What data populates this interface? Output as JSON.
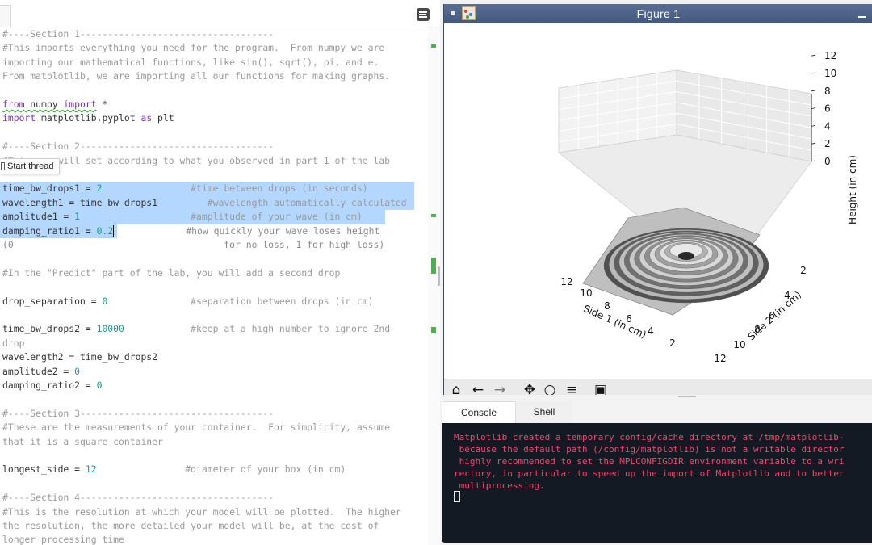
{
  "editor": {
    "lines": [
      {
        "top": 0,
        "parts": [
          {
            "t": "#----Section 1-----------------------------------",
            "c": "cm"
          }
        ]
      },
      {
        "top": 17.4,
        "parts": [
          {
            "t": "#This imports everything you need for the program.  From numpy we are",
            "c": "cm"
          }
        ]
      },
      {
        "top": 34.8,
        "parts": [
          {
            "t": "importing our mathematical functions, like sin(), sqrt(), pi, and e.",
            "c": "cm"
          }
        ]
      },
      {
        "top": 52.2,
        "parts": [
          {
            "t": "From matplotlib, we are importing all our functions for making graphs.",
            "c": "cm"
          }
        ]
      },
      {
        "top": 87,
        "parts": [
          {
            "t": "from",
            "c": "kw squiggle"
          },
          {
            "t": " numpy ",
            "c": "squiggle"
          },
          {
            "t": "import",
            "c": "kw squiggle"
          },
          {
            "t": " *",
            "c": ""
          }
        ]
      },
      {
        "top": 104.4,
        "parts": [
          {
            "t": "import",
            "c": "kw"
          },
          {
            "t": " matplotlib.pyplot ",
            "c": ""
          },
          {
            "t": "as",
            "c": "kw"
          },
          {
            "t": " plt",
            "c": ""
          }
        ]
      },
      {
        "top": 139.2,
        "parts": [
          {
            "t": "#----Section 2-----------------------------------",
            "c": "cm"
          }
        ]
      },
      {
        "top": 156.6,
        "parts": [
          {
            "t": "#This you will set according to what you observed in part 1 of the lab",
            "c": "cm"
          }
        ]
      },
      {
        "top": 191.4,
        "parts": [
          {
            "t": "time_bw_drops1 = ",
            "c": ""
          },
          {
            "t": "2",
            "c": "num"
          },
          {
            "t": "                #time between drops (in seconds)",
            "c": "cm"
          }
        ]
      },
      {
        "top": 208.8,
        "parts": [
          {
            "t": "wavelength1 = time_bw_drops1         ",
            "c": ""
          },
          {
            "t": "#wavelength automatically calculated",
            "c": "cm"
          }
        ]
      },
      {
        "top": 226.2,
        "parts": [
          {
            "t": "amplitude1 = ",
            "c": ""
          },
          {
            "t": "1",
            "c": "num"
          },
          {
            "t": "                    #amplitude of your wave (in cm)",
            "c": "cm"
          }
        ]
      },
      {
        "top": 243.6,
        "parts": [
          {
            "t": "damping_ratio1 = ",
            "c": ""
          },
          {
            "t": "0.2",
            "c": "num"
          },
          {
            "t": "|",
            "c": "caret"
          },
          {
            "t": "             #how quickly your wave loses height",
            "c": "cm-dark"
          }
        ]
      },
      {
        "top": 261,
        "parts": [
          {
            "t": "(0                                      for no loss, 1 for high loss)",
            "c": "cm-dark"
          }
        ]
      },
      {
        "top": 295.8,
        "parts": [
          {
            "t": "#In the \"Predict\" part of the lab, you will add a second drop",
            "c": "cm"
          }
        ]
      },
      {
        "top": 330.6,
        "parts": [
          {
            "t": "drop_separation = ",
            "c": ""
          },
          {
            "t": "0",
            "c": "num"
          },
          {
            "t": "               #separation between drops (in cm)",
            "c": "cm"
          }
        ]
      },
      {
        "top": 365.4,
        "parts": [
          {
            "t": "time_bw_drops2 = ",
            "c": ""
          },
          {
            "t": "10000",
            "c": "num"
          },
          {
            "t": "            #keep at a high number to ignore 2nd",
            "c": "cm"
          }
        ]
      },
      {
        "top": 382.8,
        "parts": [
          {
            "t": "drop",
            "c": "cm"
          }
        ]
      },
      {
        "top": 400.2,
        "parts": [
          {
            "t": "wavelength2 = time_bw_drops2",
            "c": ""
          }
        ]
      },
      {
        "top": 417.6,
        "parts": [
          {
            "t": "amplitude2 = ",
            "c": ""
          },
          {
            "t": "0",
            "c": "num"
          }
        ]
      },
      {
        "top": 435,
        "parts": [
          {
            "t": "damping_ratio2 = ",
            "c": ""
          },
          {
            "t": "0",
            "c": "num"
          }
        ]
      },
      {
        "top": 469.8,
        "parts": [
          {
            "t": "#----Section 3-----------------------------------",
            "c": "cm"
          }
        ]
      },
      {
        "top": 487.2,
        "parts": [
          {
            "t": "#These are the measurements of your container.  For simplicity, assume",
            "c": "cm"
          }
        ]
      },
      {
        "top": 504.6,
        "parts": [
          {
            "t": "that it is a square container",
            "c": "cm"
          }
        ]
      },
      {
        "top": 539.4,
        "parts": [
          {
            "t": "longest_side = ",
            "c": ""
          },
          {
            "t": "12",
            "c": "num"
          },
          {
            "t": "                #diameter of your box (in cm)",
            "c": "cm"
          }
        ]
      },
      {
        "top": 574.2,
        "parts": [
          {
            "t": "#----Section 4-----------------------------------",
            "c": "cm"
          }
        ]
      },
      {
        "top": 591.6,
        "parts": [
          {
            "t": "#This is the resolution at which your model will be plotted.  The higher",
            "c": "cm"
          }
        ]
      },
      {
        "top": 609,
        "parts": [
          {
            "t": "the resolution, the more detailed your model will be, at the cost of",
            "c": "cm"
          }
        ]
      },
      {
        "top": 626.4,
        "parts": [
          {
            "t": "longer processing time",
            "c": "cm"
          }
        ]
      }
    ],
    "start_thread_label": "Start thread"
  },
  "figure": {
    "title": "Figure 1",
    "toolbar_icons": [
      "home-icon",
      "back-icon",
      "forward-icon",
      "pan-icon",
      "zoom-icon",
      "configure-icon",
      "save-icon"
    ]
  },
  "chart_data": {
    "type": "surface3d",
    "zlabel": "Height (in cm)",
    "xlabel": "Side 1 (in cm)",
    "ylabel": "Side 2 (in cm)",
    "z_ticks": [
      "0",
      "2",
      "4",
      "6",
      "8",
      "10",
      "12"
    ],
    "side1_ticks": [
      "12",
      "10",
      "8",
      "6",
      "4",
      "2"
    ],
    "side2_ticks": [
      "2",
      "4",
      "6",
      "8",
      "10",
      "12"
    ],
    "xlim": [
      0,
      12
    ],
    "ylim": [
      0,
      12
    ],
    "zlim": [
      0,
      12
    ],
    "description_of_surface": "damped circular ripple centered in a 12x12 container, grayscale"
  },
  "console": {
    "tabs": [
      "Console",
      "Shell"
    ],
    "lines": [
      "Matplotlib created a temporary config/cache directory at /tmp/matplotlib-",
      " because the default path (/config/matplotlib) is not a writable director",
      " highly recommended to set the MPLCONFIGDIR environment variable to a wri",
      "rectory, in particular to speed up the import of Matplotlib and to better",
      " multiprocessing."
    ]
  },
  "colors": {
    "selection": "#b3d7ff",
    "comment": "#9a9a9a",
    "number": "#1a9a8a",
    "keyword": "#7a33b5",
    "console_bg": "#131a24",
    "console_error": "#f0476b",
    "titlebar": "#4f6289"
  }
}
